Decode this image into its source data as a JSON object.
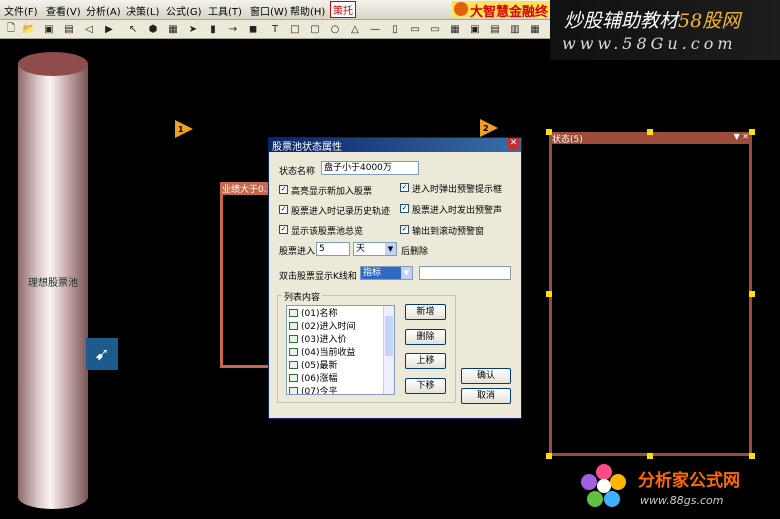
{
  "menubar": {
    "items": [
      "文件(F)",
      "查看(V)",
      "分析(A)",
      "决策(L)",
      "公式(G)",
      "工具(T)",
      "窗口(W)",
      "帮助(H)",
      "策托"
    ],
    "brand": "大智慧金融终"
  },
  "watermark_top": {
    "title_main": "炒股辅助教材",
    "title_accent": "58股网",
    "url": "www.58Gu.com"
  },
  "canvas": {
    "pool_label": "理想股票池",
    "condition_title": "业绩大于0.1",
    "flag_1": "1",
    "flag_2": "2",
    "status_title": "状态(5)",
    "status_icons": "▼ ✕"
  },
  "dialog": {
    "title": "股票池状态属性",
    "close": "✕",
    "state_name_label": "状态名称",
    "state_name_value": "盘子小于4000万",
    "checkboxes": [
      {
        "label": "高亮显示新加入股票",
        "checked": true
      },
      {
        "label": "进入时弹出预警提示框",
        "checked": true
      },
      {
        "label": "股票进入时记录历史轨迹",
        "checked": true
      },
      {
        "label": "股票进入时发出预警声",
        "checked": true
      },
      {
        "label": "显示该股票池总览",
        "checked": true
      },
      {
        "label": "输出到滚动预警窗",
        "checked": true
      }
    ],
    "enter_label": "股票进入",
    "enter_value": "5",
    "enter_unit": "天",
    "enter_suffix": "后删除",
    "dblclick_label": "双击股票显示K线和",
    "dblclick_value": "指标",
    "dblclick_extra": "",
    "list_group_title": "列表内容",
    "list_items": [
      "(01)名称",
      "(02)进入时间",
      "(03)进入价",
      "(04)当前收益",
      "(05)最新",
      "(06)涨幅",
      "(07)今平"
    ],
    "buttons": {
      "add": "新增",
      "delete": "删除",
      "up": "上移",
      "down": "下移",
      "ok": "确认",
      "cancel": "取消"
    }
  },
  "watermark_bottom": {
    "title": "分析家公式网",
    "url": "www.88gs.com"
  },
  "colors": {
    "background": "#000000",
    "condition_border": "#c8684c",
    "status_border": "#9c4c3a",
    "flag": "#f0a020",
    "handle": "#ffe000",
    "dialog_title": "#0a246a",
    "brand_red": "#dd0000"
  }
}
